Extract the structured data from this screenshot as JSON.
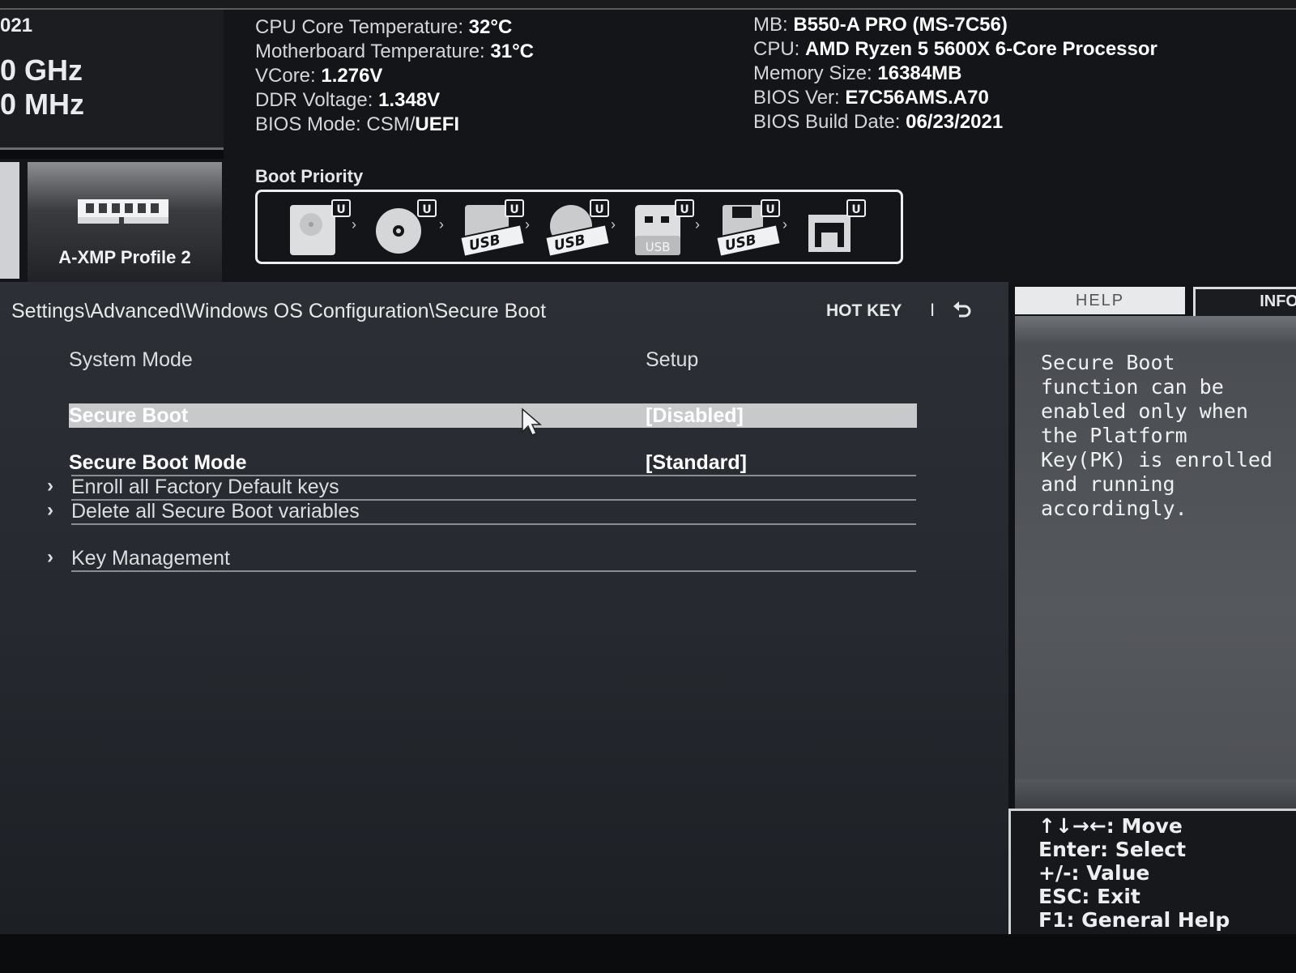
{
  "clock": {
    "year_fragment": "021",
    "cpu_speed_fragment": "0 GHz",
    "ddr_speed_fragment": "0 MHz"
  },
  "xmp": {
    "label": "A-XMP Profile 2"
  },
  "system_info": {
    "left": [
      {
        "label": "CPU Core Temperature: ",
        "value": "32°C"
      },
      {
        "label": "Motherboard Temperature: ",
        "value": "31°C"
      },
      {
        "label": "VCore: ",
        "value": "1.276V"
      },
      {
        "label": "DDR Voltage: ",
        "value": "1.348V"
      },
      {
        "label": "BIOS Mode: CSM/",
        "value": "UEFI"
      }
    ],
    "right": [
      {
        "label": "MB: ",
        "value": "B550-A PRO (MS-7C56)"
      },
      {
        "label": "CPU: ",
        "value": "AMD Ryzen 5 5600X 6-Core Processor"
      },
      {
        "label": "Memory Size: ",
        "value": "16384MB"
      },
      {
        "label": "BIOS Ver: ",
        "value": "E7C56AMS.A70"
      },
      {
        "label": "BIOS Build Date: ",
        "value": "06/23/2021"
      }
    ]
  },
  "boot_priority": {
    "title": "Boot Priority",
    "devices": [
      {
        "icon": "hard-disk-icon",
        "badge": "U",
        "text": ""
      },
      {
        "icon": "optical-disc-icon",
        "badge": "U",
        "text": ""
      },
      {
        "icon": "usb-hard-disk-icon",
        "badge": "U",
        "text": "USB"
      },
      {
        "icon": "usb-optical-disc-icon",
        "badge": "U",
        "text": "USB"
      },
      {
        "icon": "usb-key-icon",
        "badge": "U",
        "text": "USB"
      },
      {
        "icon": "usb-floppy-icon",
        "badge": "U",
        "text": "USB"
      },
      {
        "icon": "network-icon",
        "badge": "U",
        "text": ""
      }
    ]
  },
  "breadcrumb": "Settings\\Advanced\\Windows OS Configuration\\Secure Boot",
  "hotkey": {
    "label": "HOT KEY",
    "separator": "I"
  },
  "settings": {
    "system_mode": {
      "label": "System Mode",
      "value": "Setup"
    },
    "secure_boot": {
      "label": "Secure Boot",
      "value": "[Disabled]"
    },
    "secure_boot_mode": {
      "label": "Secure Boot Mode",
      "value": "[Standard]"
    },
    "enroll_keys": {
      "label": "Enroll all Factory Default keys"
    },
    "delete_vars": {
      "label": "Delete all Secure Boot variables"
    },
    "key_management": {
      "label": "Key Management"
    }
  },
  "help": {
    "tab_help": "HELP",
    "tab_info": "INFO",
    "text": "Secure Boot\nfunction can be\nenabled only when\nthe Platform\nKey(PK) is enrolled\nand running\naccordingly.",
    "keys": [
      "↑↓→←: Move",
      "Enter: Select",
      "+/-: Value",
      "ESC: Exit",
      "F1: General Help"
    ]
  },
  "colors": {
    "selected_row": "#c7c9cb",
    "background": "#262a30",
    "text": "#dcdee0"
  }
}
